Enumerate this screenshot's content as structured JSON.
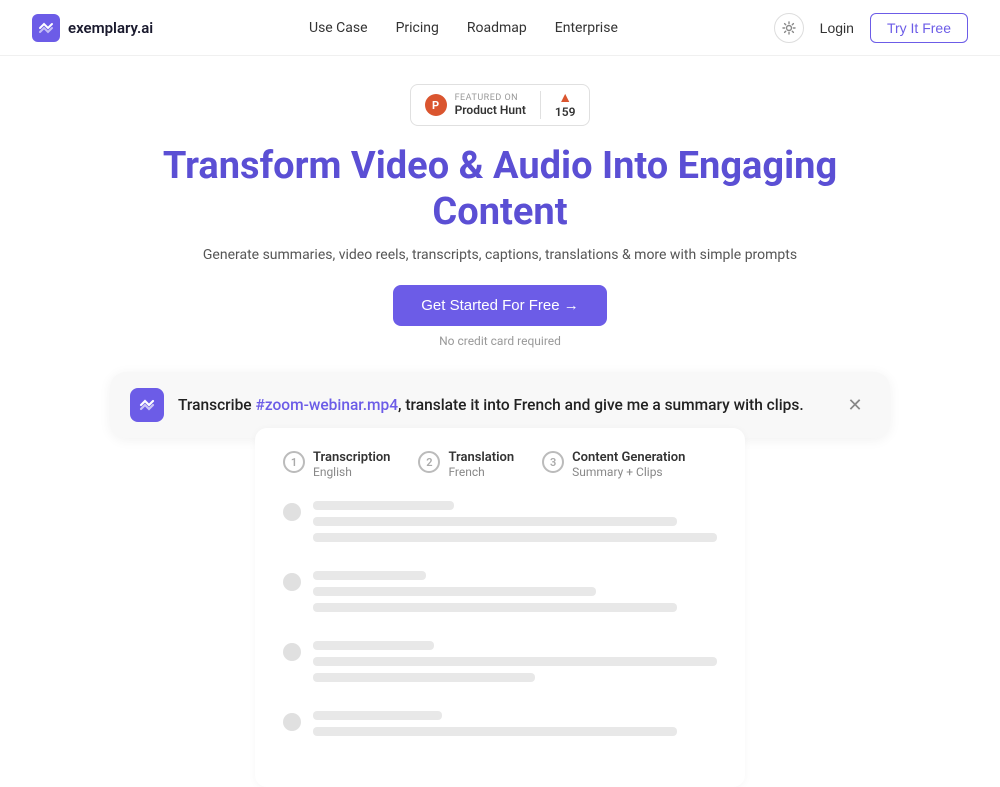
{
  "nav": {
    "logo_text": "exemplary.ai",
    "links": [
      {
        "label": "Use Case",
        "id": "use-case"
      },
      {
        "label": "Pricing",
        "id": "pricing"
      },
      {
        "label": "Roadmap",
        "id": "roadmap"
      },
      {
        "label": "Enterprise",
        "id": "enterprise"
      }
    ],
    "login_label": "Login",
    "try_free_label": "Try It Free"
  },
  "ph_badge": {
    "featured_text": "FEATURED ON",
    "name": "Product Hunt",
    "count": "159"
  },
  "hero": {
    "headline": "Transform Video & Audio Into Engaging Content",
    "subheadline": "Generate summaries, video reels, transcripts, captions, translations & more with simple prompts",
    "cta_label": "Get Started For Free →",
    "no_cc": "No credit card required"
  },
  "prompt": {
    "text_before": "Transcribe ",
    "highlight": "#zoom-webinar.mp4",
    "text_after": ", translate it into French and give me a summary with clips."
  },
  "steps": [
    {
      "num": "1",
      "title": "Transcription",
      "sub": "English"
    },
    {
      "num": "2",
      "title": "Translation",
      "sub": "French"
    },
    {
      "num": "3",
      "title": "Content Generation",
      "sub": "Summary + Clips"
    }
  ],
  "icons": {
    "close": "✕",
    "arrow_up": "▲"
  }
}
